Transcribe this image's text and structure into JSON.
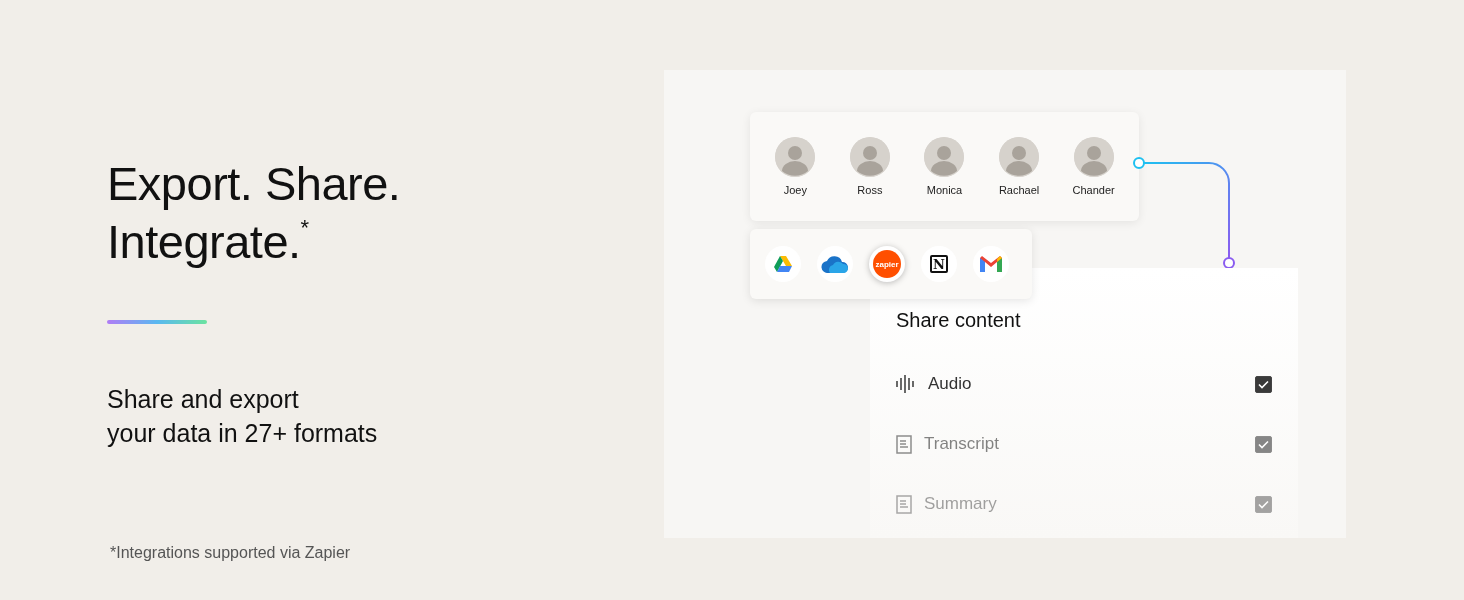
{
  "headline": "Export. Share. Integrate.$^{*}$",
  "subtitle_lines": [
    "Share and export",
    "your data in 27+ formats"
  ],
  "footnote": "*Integrations supported via Zapier",
  "people": [
    {
      "name": "Joey"
    },
    {
      "name": "Ross"
    },
    {
      "name": "Monica"
    },
    {
      "name": "Rachael"
    },
    {
      "name": "Chander"
    }
  ],
  "integrations": [
    {
      "kind": "drive",
      "selected": false
    },
    {
      "kind": "cloud",
      "selected": false
    },
    {
      "kind": "zapier",
      "label": "zapier",
      "selected": true
    },
    {
      "kind": "notion",
      "label": "N",
      "selected": false
    },
    {
      "kind": "mail",
      "selected": false
    }
  ],
  "share": {
    "title": "Share content",
    "items": [
      {
        "kind": "audio",
        "label": "Audio",
        "checked": true
      },
      {
        "kind": "document",
        "label": "Transcript",
        "checked": true
      },
      {
        "kind": "document",
        "label": "Summary",
        "checked": true
      }
    ]
  }
}
